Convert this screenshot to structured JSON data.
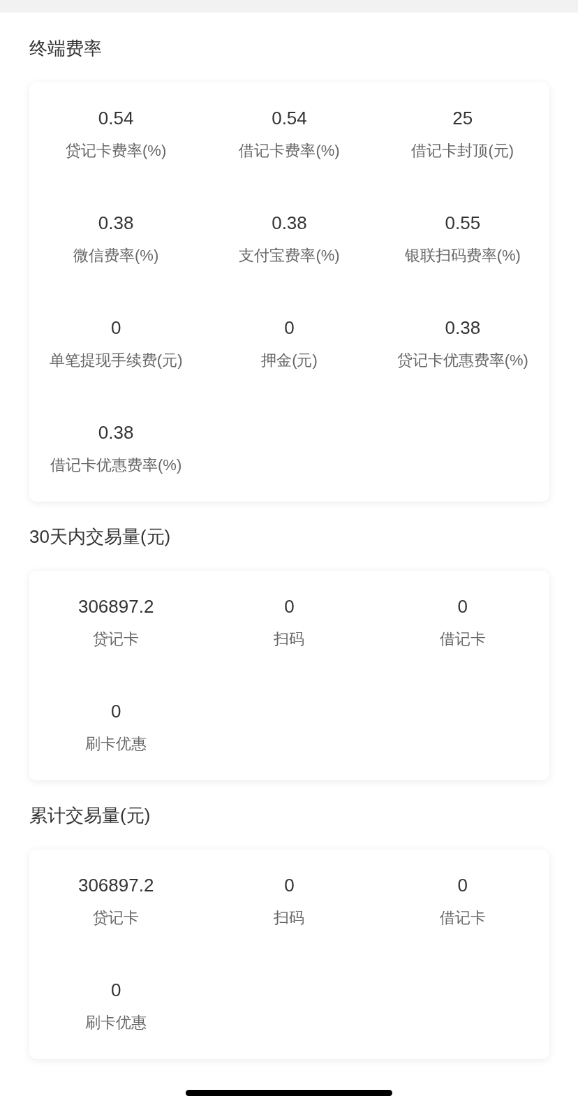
{
  "sections": [
    {
      "title": "终端费率",
      "items": [
        {
          "value": "0.54",
          "label": "贷记卡费率(%)"
        },
        {
          "value": "0.54",
          "label": "借记卡费率(%)"
        },
        {
          "value": "25",
          "label": "借记卡封顶(元)"
        },
        {
          "value": "0.38",
          "label": "微信费率(%)"
        },
        {
          "value": "0.38",
          "label": "支付宝费率(%)"
        },
        {
          "value": "0.55",
          "label": "银联扫码费率(%)"
        },
        {
          "value": "0",
          "label": "单笔提现手续费(元)"
        },
        {
          "value": "0",
          "label": "押金(元)"
        },
        {
          "value": "0.38",
          "label": "贷记卡优惠费率(%)"
        },
        {
          "value": "0.38",
          "label": "借记卡优惠费率(%)"
        }
      ]
    },
    {
      "title": "30天内交易量(元)",
      "items": [
        {
          "value": "306897.2",
          "label": "贷记卡"
        },
        {
          "value": "0",
          "label": "扫码"
        },
        {
          "value": "0",
          "label": "借记卡"
        },
        {
          "value": "0",
          "label": "刷卡优惠"
        }
      ]
    },
    {
      "title": "累计交易量(元)",
      "items": [
        {
          "value": "306897.2",
          "label": "贷记卡"
        },
        {
          "value": "0",
          "label": "扫码"
        },
        {
          "value": "0",
          "label": "借记卡"
        },
        {
          "value": "0",
          "label": "刷卡优惠"
        }
      ]
    }
  ]
}
